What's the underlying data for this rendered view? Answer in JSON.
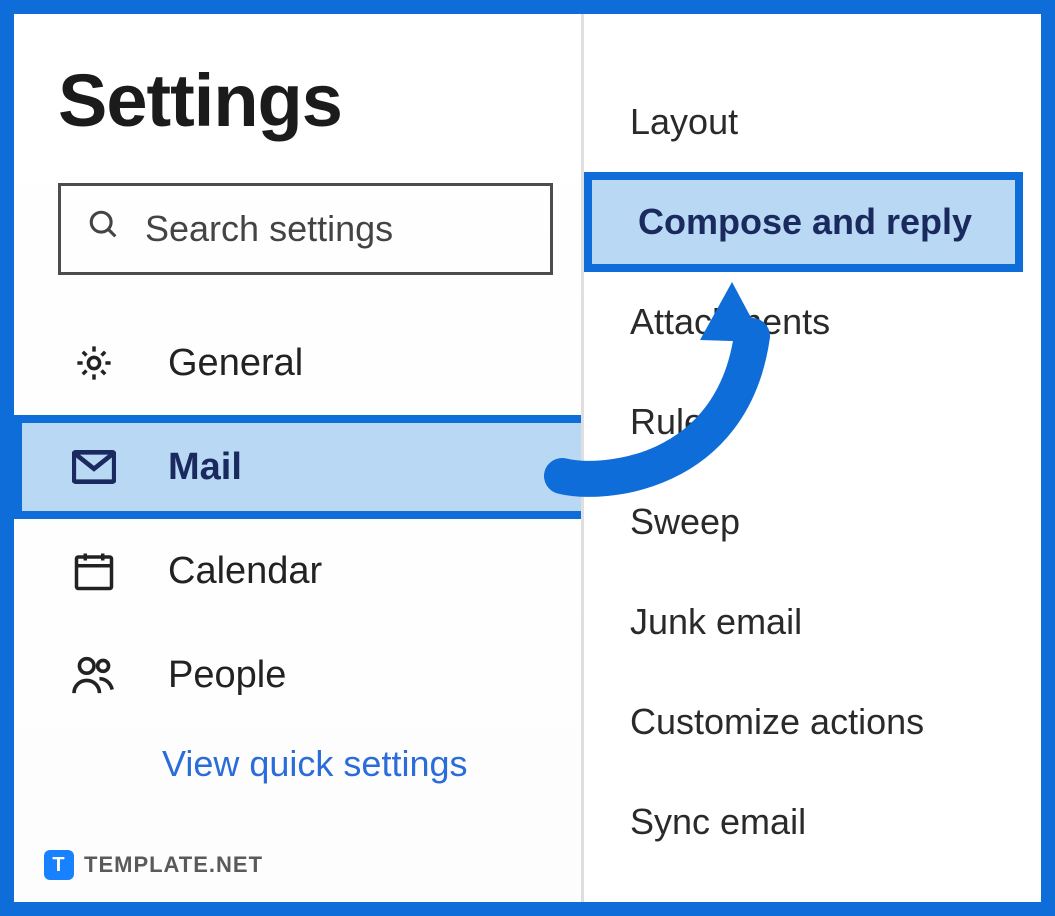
{
  "title": "Settings",
  "search": {
    "placeholder": "Search settings"
  },
  "categories": [
    {
      "label": "General",
      "icon": "gear-icon"
    },
    {
      "label": "Mail",
      "icon": "mail-icon",
      "selected": true
    },
    {
      "label": "Calendar",
      "icon": "calendar-icon"
    },
    {
      "label": "People",
      "icon": "people-icon"
    }
  ],
  "quick_settings_label": "View quick settings",
  "subpane": {
    "items": [
      {
        "label": "Layout"
      },
      {
        "label": "Compose and reply",
        "selected": true
      },
      {
        "label": "Attachments"
      },
      {
        "label": "Rules"
      },
      {
        "label": "Sweep"
      },
      {
        "label": "Junk email"
      },
      {
        "label": "Customize actions"
      },
      {
        "label": "Sync email"
      }
    ]
  },
  "watermark": {
    "badge": "T",
    "text": "TEMPLATE.NET"
  },
  "colors": {
    "accent": "#0e6dd8",
    "accent_light": "#b9d8f4"
  }
}
